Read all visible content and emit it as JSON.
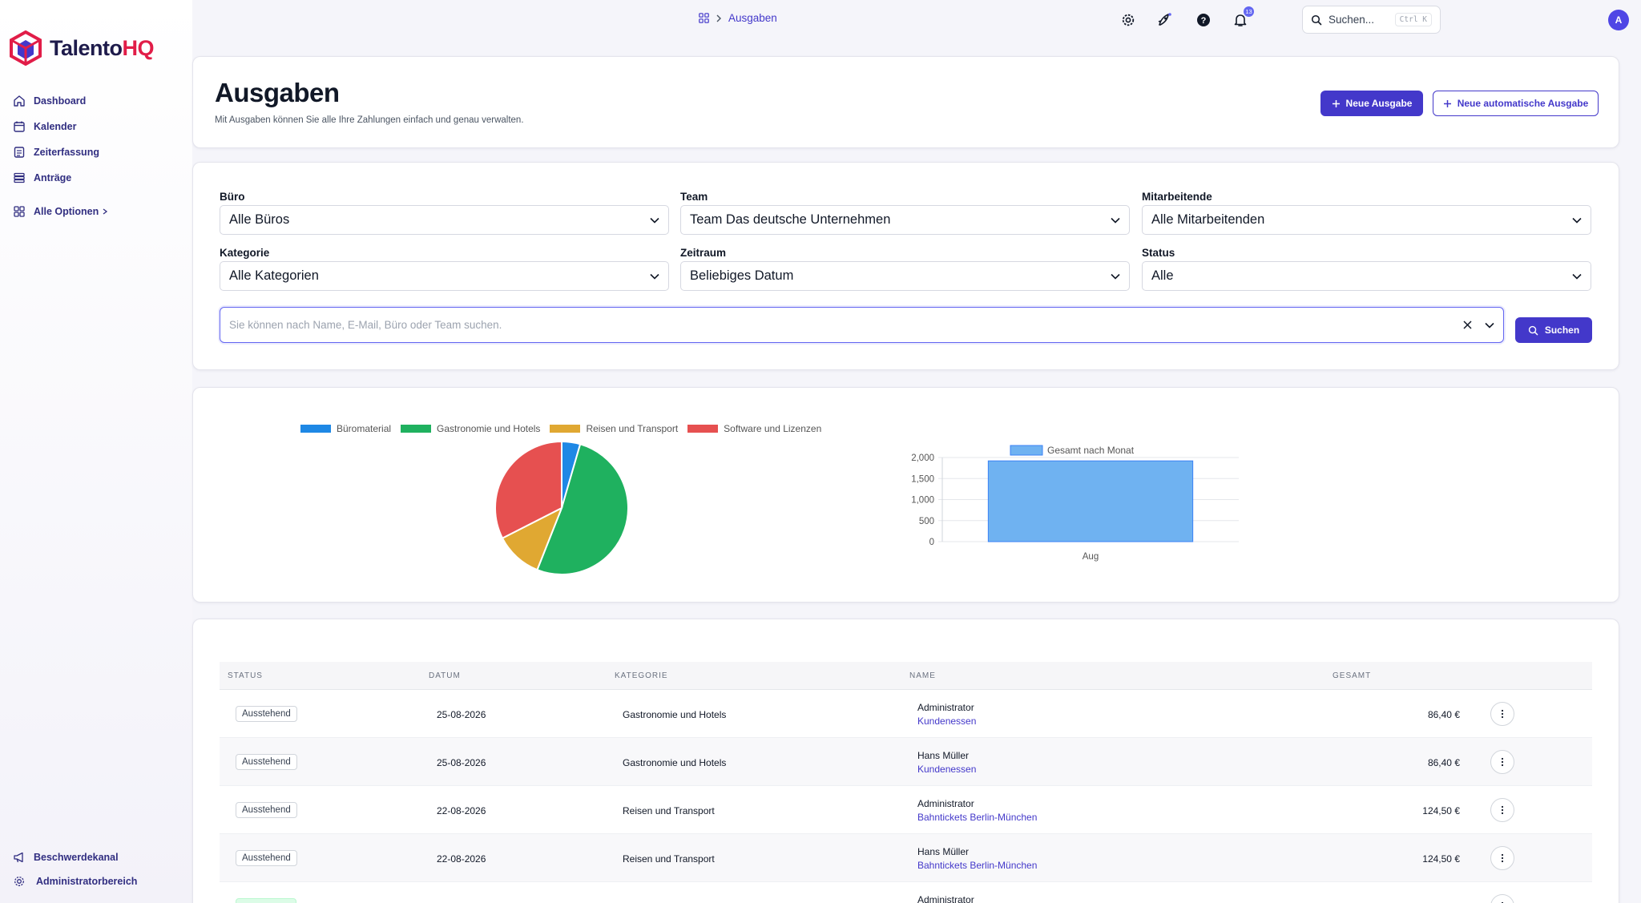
{
  "app": {
    "brand_main": "Talento",
    "brand_accent": "HQ",
    "brand_color": "#1e1b4b",
    "accent_color": "#e11d48",
    "primary_color": "#4338ca"
  },
  "sidebar": {
    "items": [
      {
        "label": "Dashboard",
        "icon": "home-icon"
      },
      {
        "label": "Kalender",
        "icon": "calendar-icon"
      },
      {
        "label": "Zeiterfassung",
        "icon": "clock-icon"
      },
      {
        "label": "Anträge",
        "icon": "stack-icon"
      }
    ],
    "all_options": "Alle Optionen",
    "bottom": [
      {
        "label": "Beschwerdekanal",
        "icon": "megaphone-icon"
      },
      {
        "label": "Administratorbereich",
        "icon": "gear-icon"
      }
    ]
  },
  "topbar": {
    "breadcrumb": "Ausgaben",
    "search_placeholder": "Suchen...",
    "search_shortcut": "Ctrl K",
    "notification_count": "13",
    "avatar_initial": "A"
  },
  "header": {
    "title": "Ausgaben",
    "subtitle": "Mit Ausgaben können Sie alle Ihre Zahlungen einfach und genau verwalten.",
    "new_button": "Neue Ausgabe",
    "new_auto_button": "Neue automatische Ausgabe"
  },
  "filters": {
    "office": {
      "label": "Büro",
      "value": "Alle Büros"
    },
    "team": {
      "label": "Team",
      "value": "Team Das deutsche Unternehmen"
    },
    "employees": {
      "label": "Mitarbeitende",
      "value": "Alle Mitarbeitenden"
    },
    "category": {
      "label": "Kategorie",
      "value": "Alle Kategorien"
    },
    "period": {
      "label": "Zeitraum",
      "value": "Beliebiges Datum"
    },
    "status": {
      "label": "Status",
      "value": "Alle"
    },
    "search_placeholder": "Sie können nach Name, E-Mail, Büro oder Team suchen.",
    "search_value": "",
    "search_button": "Suchen"
  },
  "chart_data": [
    {
      "type": "pie",
      "categories": [
        "Büromaterial",
        "Gastronomie und Hotels",
        "Reisen und Transport",
        "Software und Lizenzen"
      ],
      "values": [
        4.5,
        51.5,
        11.5,
        32.5
      ],
      "colors": [
        "#1e88e5",
        "#1fb15f",
        "#e0a832",
        "#e65050"
      ]
    },
    {
      "type": "bar",
      "categories": [
        "Aug"
      ],
      "series": [
        {
          "name": "Gesamt nach Monat",
          "values": [
            1920
          ]
        }
      ],
      "ylim": [
        0,
        2000
      ],
      "yticks": [
        "2,000",
        "1,500",
        "1,000",
        "500",
        "0"
      ],
      "bar_color": "#6fb2f1",
      "grid": true,
      "legend": "top"
    }
  ],
  "table": {
    "headers": {
      "status": "STATUS",
      "date": "DATUM",
      "category": "KATEGORIE",
      "name": "NAME",
      "total": "GESAMT"
    },
    "rows": [
      {
        "status": "Ausstehend",
        "date": "25-08-2026",
        "category": "Gastronomie und Hotels",
        "who": "Administrator",
        "desc": "Kundenessen",
        "total": "86,40 €"
      },
      {
        "status": "Ausstehend",
        "date": "25-08-2026",
        "category": "Gastronomie und Hotels",
        "who": "Hans Müller",
        "desc": "Kundenessen",
        "total": "86,40 €"
      },
      {
        "status": "Ausstehend",
        "date": "22-08-2026",
        "category": "Reisen und Transport",
        "who": "Administrator",
        "desc": "Bahntickets Berlin-München",
        "total": "124,50 €"
      },
      {
        "status": "Ausstehend",
        "date": "22-08-2026",
        "category": "Reisen und Transport",
        "who": "Hans Müller",
        "desc": "Bahntickets Berlin-München",
        "total": "124,50 €"
      },
      {
        "status": "",
        "date": "",
        "category": "",
        "who": "Administrator",
        "desc": "",
        "total": ""
      }
    ]
  }
}
